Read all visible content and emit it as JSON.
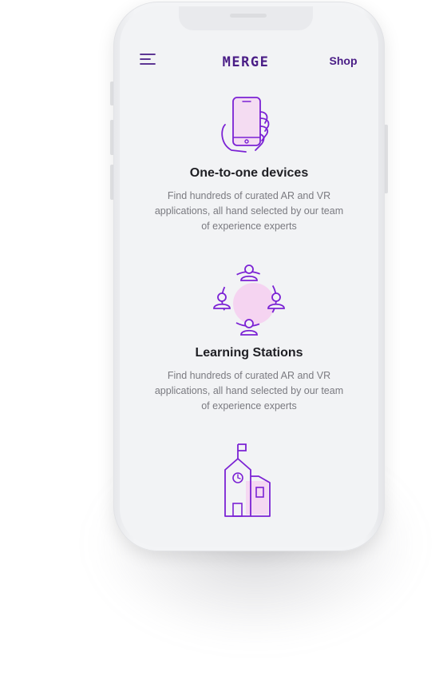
{
  "header": {
    "logo_text": "MERGE",
    "shop_label": "Shop",
    "menu_icon": "hamburger-menu-icon"
  },
  "sections": [
    {
      "icon": "phone-in-hand-icon",
      "title": "One-to-one devices",
      "description": "Find hundreds of curated AR and VR applications, all hand selected by our team of experience experts"
    },
    {
      "icon": "group-circle-icon",
      "title": "Learning Stations",
      "description": "Find hundreds of curated AR and VR applications, all hand selected by our team of experience experts"
    },
    {
      "icon": "school-building-icon"
    }
  ],
  "colors": {
    "brand_purple": "#4a1d86",
    "icon_purple": "#7b22d4",
    "icon_highlight": "#f6c9ef",
    "screen_background": "#f2f3f5",
    "title_text": "#1f1f24",
    "body_text": "#7a7a80"
  }
}
